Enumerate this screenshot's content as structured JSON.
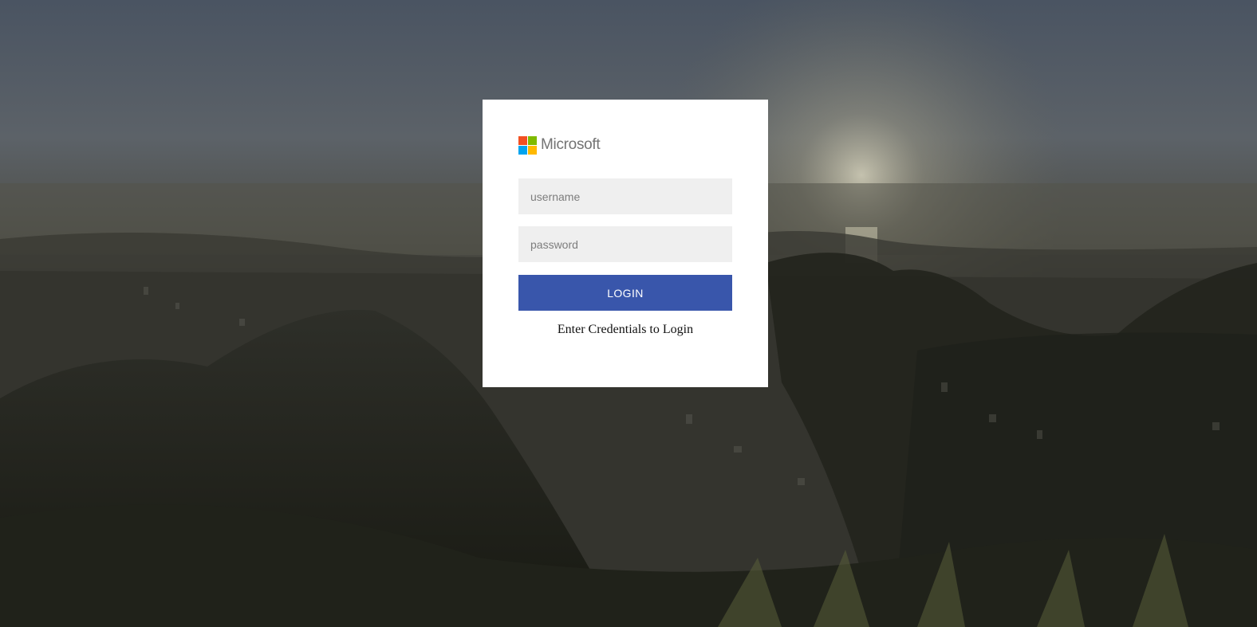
{
  "brand": {
    "name": "Microsoft",
    "logo_colors": [
      "#f25022",
      "#7fba00",
      "#00a4ef",
      "#ffb900"
    ]
  },
  "form": {
    "username_placeholder": "username",
    "username_value": "",
    "password_placeholder": "password",
    "password_value": "",
    "login_label": "LOGIN",
    "message": "Enter Credentials to Login"
  },
  "colors": {
    "button": "#3956ab",
    "field_bg": "#efefef",
    "card_bg": "#ffffff"
  },
  "background": {
    "description_icon": "landscape-photo"
  }
}
